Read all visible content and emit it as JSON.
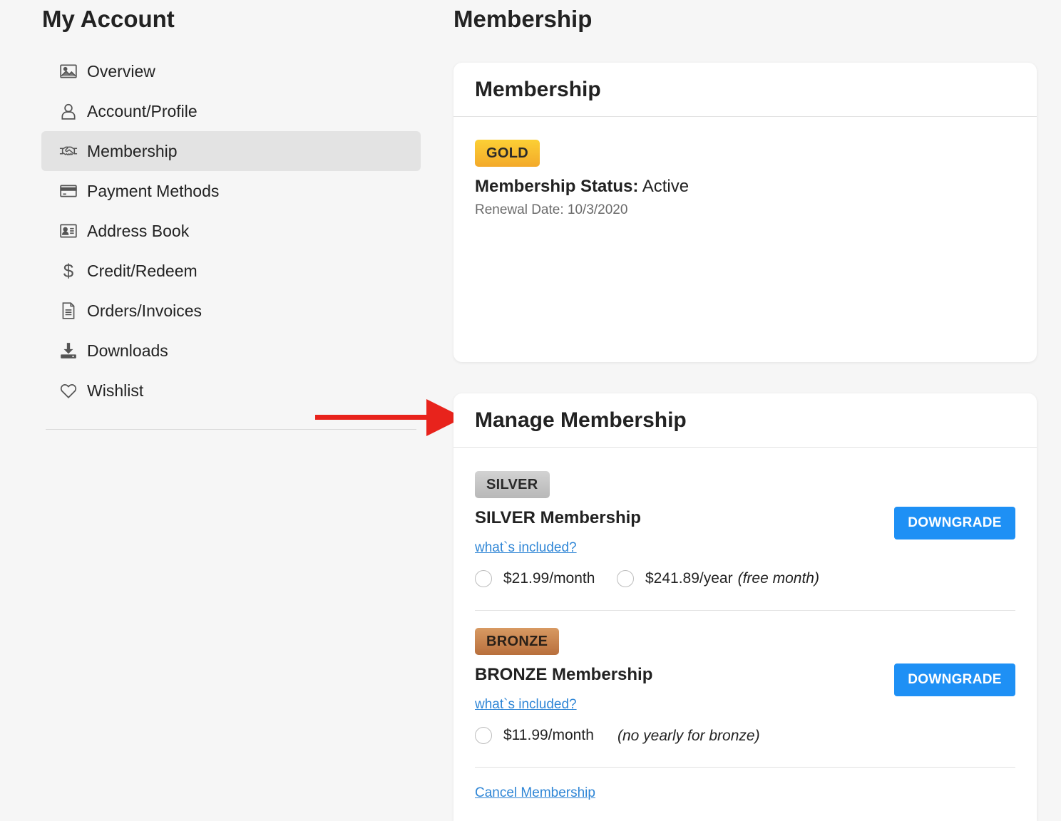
{
  "account": {
    "title": "My Account"
  },
  "page": {
    "title": "Membership"
  },
  "sidebar": {
    "items": [
      {
        "label": "Overview",
        "icon": "image-icon",
        "active": false
      },
      {
        "label": "Account/Profile",
        "icon": "user-icon",
        "active": false
      },
      {
        "label": "Membership",
        "icon": "handshake-icon",
        "active": true
      },
      {
        "label": "Payment Methods",
        "icon": "credit-card-icon",
        "active": false
      },
      {
        "label": "Address Book",
        "icon": "address-card-icon",
        "active": false
      },
      {
        "label": "Credit/Redeem",
        "icon": "dollar-icon",
        "active": false
      },
      {
        "label": "Orders/Invoices",
        "icon": "document-icon",
        "active": false
      },
      {
        "label": "Downloads",
        "icon": "download-icon",
        "active": false
      },
      {
        "label": "Wishlist",
        "icon": "heart-icon",
        "active": false
      }
    ]
  },
  "membership_card": {
    "header": "Membership",
    "badge": "GOLD",
    "status_label": "Membership Status:",
    "status_value": "Active",
    "renewal": "Renewal Date: 10/3/2020"
  },
  "manage_card": {
    "header": "Manage Membership",
    "silver": {
      "badge": "SILVER",
      "title": "SILVER Membership",
      "link": "what`s included?",
      "button": "DOWNGRADE",
      "monthly": "$21.99/month",
      "yearly": "$241.89/year",
      "yearly_note": "(free month)"
    },
    "bronze": {
      "badge": "BRONZE",
      "title": "BRONZE Membership",
      "link": "what`s included?",
      "button": "DOWNGRADE",
      "monthly": "$11.99/month",
      "note": "(no yearly for bronze)"
    },
    "cancel": "Cancel Membership"
  },
  "colors": {
    "accent": "#1e90f5",
    "link": "#2f86d6",
    "annotation_arrow": "#e8231c"
  }
}
